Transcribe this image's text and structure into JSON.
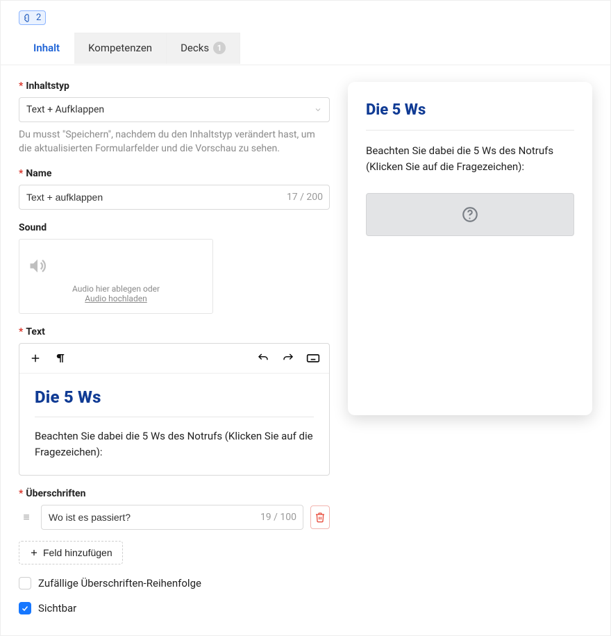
{
  "badge": {
    "count": "2"
  },
  "tabs": {
    "content": "Inhalt",
    "competencies": "Kompetenzen",
    "decks": "Decks",
    "decks_count": "1"
  },
  "labels": {
    "contentType": "Inhaltstyp",
    "name": "Name",
    "sound": "Sound",
    "text": "Text",
    "headings": "Überschriften",
    "addField": "Feld hinzufügen",
    "randomOrder": "Zufällige Überschriften-Reihenfolge",
    "visible": "Sichtbar"
  },
  "contentType": {
    "value": "Text + Aufklappen"
  },
  "contentTypeHelp": "Du musst \"Speichern\", nachdem du den Inhaltstyp verändert hast, um die aktualisierten Formularfelder und die Vorschau zu sehen.",
  "name": {
    "value": "Text + aufklappen",
    "counter": "17 / 200"
  },
  "sound": {
    "line1": "Audio hier ablegen oder",
    "line2": "Audio hochladen"
  },
  "text": {
    "title": "Die 5 Ws",
    "body": "Beachten Sie dabei die 5 Ws des Notrufs (Klicken Sie auf die Fragezeichen):"
  },
  "headings": [
    {
      "value": "Wo ist es passiert?",
      "counter": "19 / 100"
    }
  ],
  "options": {
    "randomOrder": false,
    "visible": true
  },
  "preview": {
    "title": "Die 5 Ws",
    "body": "Beachten Sie dabei die 5 Ws des Notrufs (Klicken Sie auf die Fragezeichen):"
  }
}
